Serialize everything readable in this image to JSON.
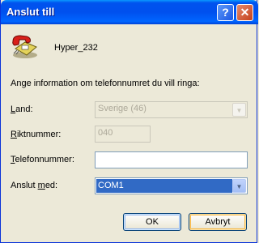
{
  "window": {
    "title": "Anslut till",
    "help_label": "?",
    "close_label": "✕"
  },
  "connection": {
    "icon": "phone-icon",
    "name": "Hyper_232"
  },
  "info_text": "Ange information om telefonnumret du vill ringa:",
  "fields": {
    "country_label_key": "L",
    "country_label_rest": "and:",
    "country_value": "Sverige (46)",
    "area_label_key": "R",
    "area_label_rest": "iktnummer:",
    "area_value": "040",
    "phone_label_key": "T",
    "phone_label_rest": "elefonnummer:",
    "phone_value": "",
    "connect_label_pre": "Anslut ",
    "connect_label_key": "m",
    "connect_label_rest": "ed:",
    "connect_value": "COM1"
  },
  "buttons": {
    "ok": "OK",
    "cancel": "Avbryt"
  },
  "colors": {
    "title_bar": "#0054e3",
    "selection": "#316ac5",
    "dialog_bg": "#ece9d8"
  }
}
